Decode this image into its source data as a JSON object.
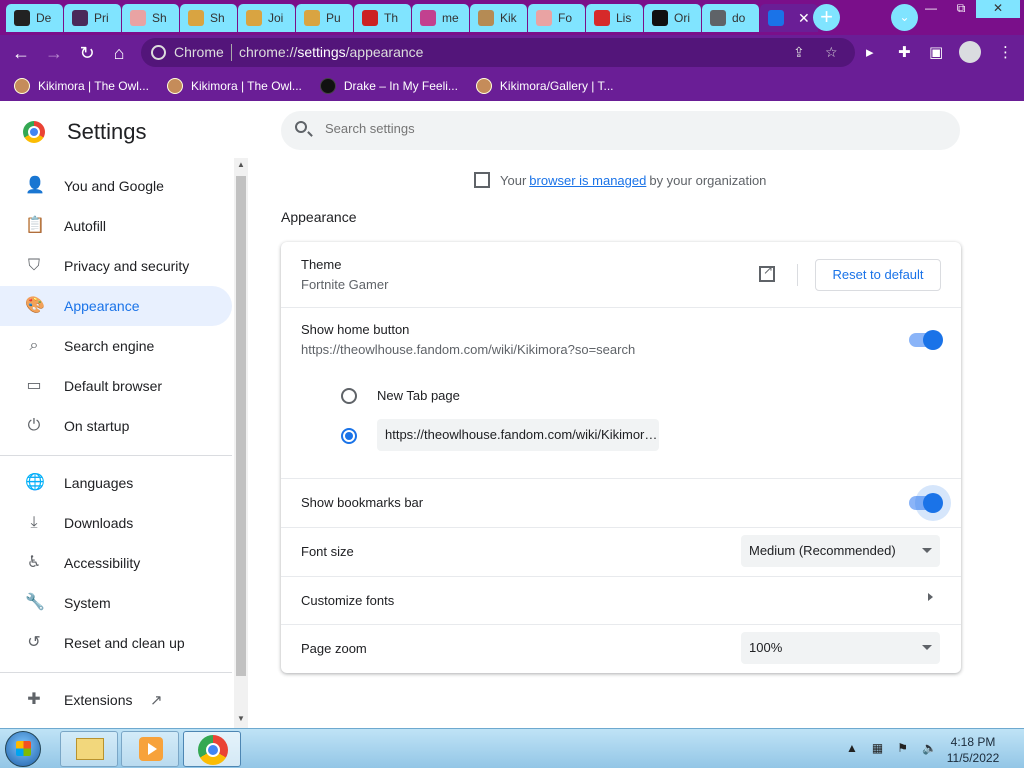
{
  "tabs": [
    {
      "title": "De",
      "favicon_color": "#222222"
    },
    {
      "title": "Pri",
      "favicon_color": "#4a2a5a"
    },
    {
      "title": "Sh",
      "favicon_color": "#e9a3a3"
    },
    {
      "title": "Sh",
      "favicon_color": "#d9a441"
    },
    {
      "title": "Joi",
      "favicon_color": "#d9a441"
    },
    {
      "title": "Pu",
      "favicon_color": "#d9a441"
    },
    {
      "title": "Th",
      "favicon_color": "#cc2222"
    },
    {
      "title": "me",
      "favicon_color": "#c2418f"
    },
    {
      "title": "Kik",
      "favicon_color": "#b58b54"
    },
    {
      "title": "Fo",
      "favicon_color": "#e9a3a3"
    },
    {
      "title": "Lis",
      "favicon_color": "#d62a2a"
    },
    {
      "title": "Ori",
      "favicon_color": "#111111"
    },
    {
      "title": "do",
      "favicon_color": "#5f6368"
    },
    {
      "title": "",
      "favicon_color": "#1a73e8",
      "active": true
    }
  ],
  "tab_close_glyph": "✕",
  "new_tab_glyph": "+",
  "tab_search_glyph": "⌄",
  "window_controls": {
    "minimize": "—",
    "restore": "⧉",
    "close": "✕"
  },
  "toolbar": {
    "back": "←",
    "forward": "→",
    "reload": "↻",
    "home": "⌂",
    "site_label": "Chrome",
    "url_prefix": "chrome://",
    "url_path": "settings",
    "url_rest": "/appearance",
    "share_icon": "⇪",
    "star_icon": "☆",
    "media_icon": "▸",
    "extensions_icon": "✚",
    "sidepanel_icon": "▣",
    "menu_icon": "⋮"
  },
  "bookmarks": [
    {
      "label": "Kikimora | The Owl...",
      "icon": "owl-house-icon"
    },
    {
      "label": "Kikimora | The Owl...",
      "icon": "owl-house-icon"
    },
    {
      "label": "Drake – In My Feeli...",
      "icon": "genius-icon"
    },
    {
      "label": "Kikimora/Gallery | T...",
      "icon": "owl-house-icon"
    }
  ],
  "settings": {
    "title": "Settings",
    "search_placeholder": "Search settings",
    "managed": {
      "prefix": "Your",
      "link": "browser is managed",
      "suffix": "by your organization"
    },
    "section_title": "Appearance"
  },
  "sidebar": {
    "items": [
      {
        "label": "You and Google",
        "icon": "person-icon",
        "glyph": "👤"
      },
      {
        "label": "Autofill",
        "icon": "clipboard-icon",
        "glyph": "📋"
      },
      {
        "label": "Privacy and security",
        "icon": "shield-icon",
        "glyph": "⛉"
      },
      {
        "label": "Appearance",
        "icon": "palette-icon",
        "glyph": "🎨",
        "active": true
      },
      {
        "label": "Search engine",
        "icon": "search-icon",
        "glyph": "⌕"
      },
      {
        "label": "Default browser",
        "icon": "browser-icon",
        "glyph": "▭"
      },
      {
        "label": "On startup",
        "icon": "power-icon",
        "glyph": "⏻"
      },
      {
        "label": "Languages",
        "icon": "globe-icon",
        "glyph": "🌐"
      },
      {
        "label": "Downloads",
        "icon": "download-icon",
        "glyph": "⤓"
      },
      {
        "label": "Accessibility",
        "icon": "accessibility-icon",
        "glyph": "♿"
      },
      {
        "label": "System",
        "icon": "wrench-icon",
        "glyph": "🔧"
      },
      {
        "label": "Reset and clean up",
        "icon": "history-icon",
        "glyph": "↺"
      },
      {
        "label": "Extensions",
        "icon": "puzzle-icon",
        "glyph": "✚"
      }
    ]
  },
  "appearance": {
    "theme_label": "Theme",
    "theme_value": "Fortnite Gamer",
    "reset_button": "Reset to default",
    "home_button_label": "Show home button",
    "home_button_url": "https://theowlhouse.fandom.com/wiki/Kikimora?so=search",
    "home_button_enabled": true,
    "option_new_tab": "New Tab page",
    "option_custom_url": "https://theowlhouse.fandom.com/wiki/Kikimora?so=search",
    "selected_option": "custom_url",
    "bookmarks_bar_label": "Show bookmarks bar",
    "bookmarks_bar_enabled": true,
    "font_size_label": "Font size",
    "font_size_value": "Medium (Recommended)",
    "customize_fonts_label": "Customize fonts",
    "page_zoom_label": "Page zoom",
    "page_zoom_value": "100%"
  },
  "taskbar": {
    "apps": [
      {
        "name": "file-explorer"
      },
      {
        "name": "media-player"
      },
      {
        "name": "chrome",
        "active": true
      }
    ],
    "time": "4:18 PM",
    "date": "11/5/2022"
  }
}
